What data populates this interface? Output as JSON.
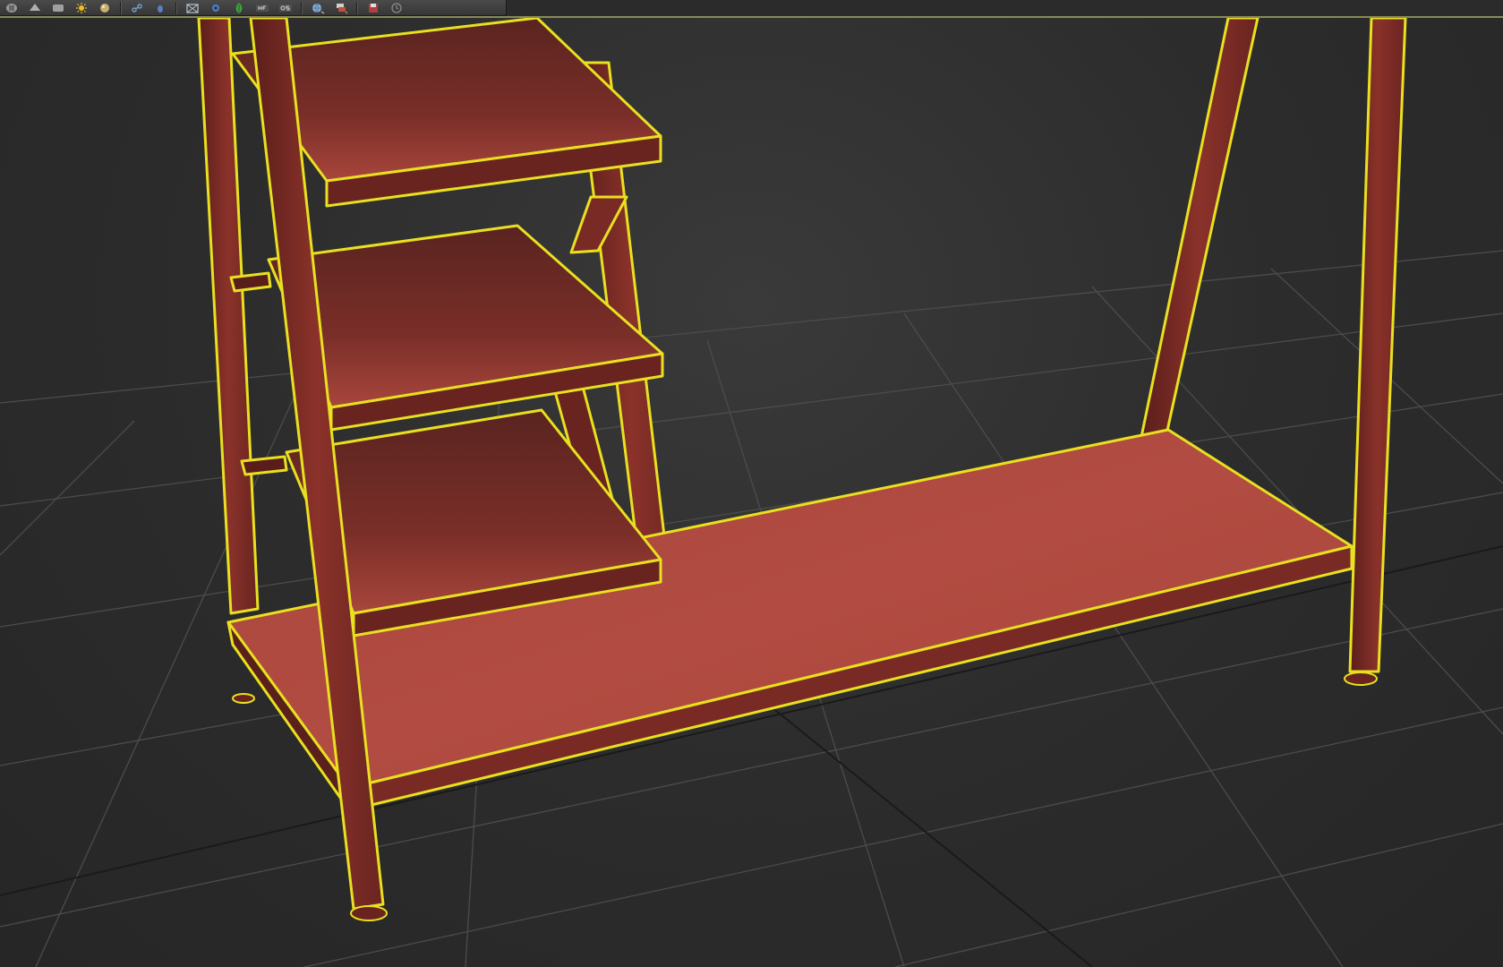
{
  "app": {
    "colors": {
      "viewport_bg": "#2b2b2b",
      "grid_line": "#4a4a4a",
      "model_red": "#b04a40",
      "model_dark": "#6a2822",
      "selection_outline": "#e8e020"
    }
  },
  "toolbar": {
    "buttons": [
      {
        "name": "render-setup-icon"
      },
      {
        "name": "rendered-frame-icon"
      },
      {
        "name": "render-production-icon"
      },
      {
        "name": "sun-light-icon"
      },
      {
        "name": "material-sphere-icon"
      },
      {
        "name": "link-icon"
      },
      {
        "name": "bind-icon"
      },
      {
        "name": "envelope-icon"
      },
      {
        "name": "gear-icon"
      },
      {
        "name": "leaf-icon"
      },
      {
        "name": "hf-label-icon"
      },
      {
        "name": "os-label-icon"
      },
      {
        "name": "globe-icon"
      },
      {
        "name": "layers-icon"
      },
      {
        "name": "save-icon"
      },
      {
        "name": "clock-icon"
      }
    ]
  },
  "viewport": {
    "object": "shelving-unit",
    "selected": true
  }
}
